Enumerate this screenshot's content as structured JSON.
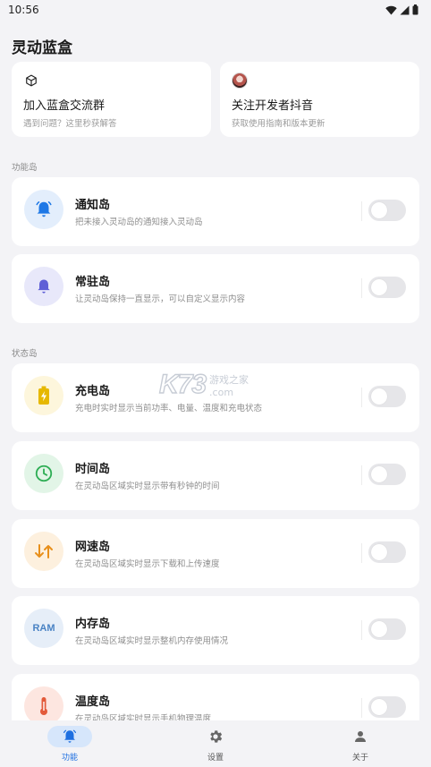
{
  "status_bar": {
    "time": "10:56"
  },
  "app_title": "灵动蓝盒",
  "top_cards": [
    {
      "title": "加入蓝盒交流群",
      "subtitle": "遇到问题？这里秒获解答",
      "icon": "cube-icon"
    },
    {
      "title": "关注开发者抖音",
      "subtitle": "获取使用指南和版本更新",
      "icon": "avatar"
    }
  ],
  "sections": {
    "function_label": "功能岛",
    "status_label": "状态岛"
  },
  "features": [
    {
      "title": "通知岛",
      "desc": "把未接入灵动岛的通知接入灵动岛",
      "icon": "bell-ringing-icon",
      "icon_bg": "#e3eefc",
      "icon_color": "#1e78e6",
      "enabled": false
    },
    {
      "title": "常驻岛",
      "desc": "让灵动岛保持一直显示，可以自定义显示内容",
      "icon": "bell-icon",
      "icon_bg": "#e8e8fa",
      "icon_color": "#5f5fd6",
      "enabled": false
    },
    {
      "title": "充电岛",
      "desc": "充电时实时显示当前功率、电量、温度和充电状态",
      "icon": "battery-charging-icon",
      "icon_bg": "#fdf6dc",
      "icon_color": "#e6b800",
      "enabled": false
    },
    {
      "title": "时间岛",
      "desc": "在灵动岛区域实时显示带有秒钟的时间",
      "icon": "clock-icon",
      "icon_bg": "#e2f5e7",
      "icon_color": "#2fae55",
      "enabled": false
    },
    {
      "title": "网速岛",
      "desc": "在灵动岛区域实时显示下载和上传速度",
      "icon": "arrows-up-down-icon",
      "icon_bg": "#fdf0de",
      "icon_color": "#e8901c",
      "enabled": false
    },
    {
      "title": "内存岛",
      "desc": "在灵动岛区域实时显示整机内存使用情况",
      "icon": "ram-icon",
      "icon_text": "RAM",
      "icon_bg": "#e6eef8",
      "icon_color": "#4a83c4",
      "enabled": false
    },
    {
      "title": "温度岛",
      "desc": "在灵动岛区域实时显示手机物理温度",
      "icon": "thermometer-icon",
      "icon_bg": "#fde6e0",
      "icon_color": "#e35a3a",
      "enabled": false
    }
  ],
  "watermark": {
    "logo": "K73",
    "cn": "游戏之家",
    "domain": ".com"
  },
  "bottom_nav": [
    {
      "label": "功能",
      "icon": "bell-icon",
      "active": true
    },
    {
      "label": "设置",
      "icon": "gear-icon",
      "active": false
    },
    {
      "label": "关于",
      "icon": "person-icon",
      "active": false
    }
  ],
  "colors": {
    "accent": "#1e6fe0",
    "background": "#f3f3f6",
    "card": "#ffffff",
    "toggle_off": "#e6e6e9"
  }
}
